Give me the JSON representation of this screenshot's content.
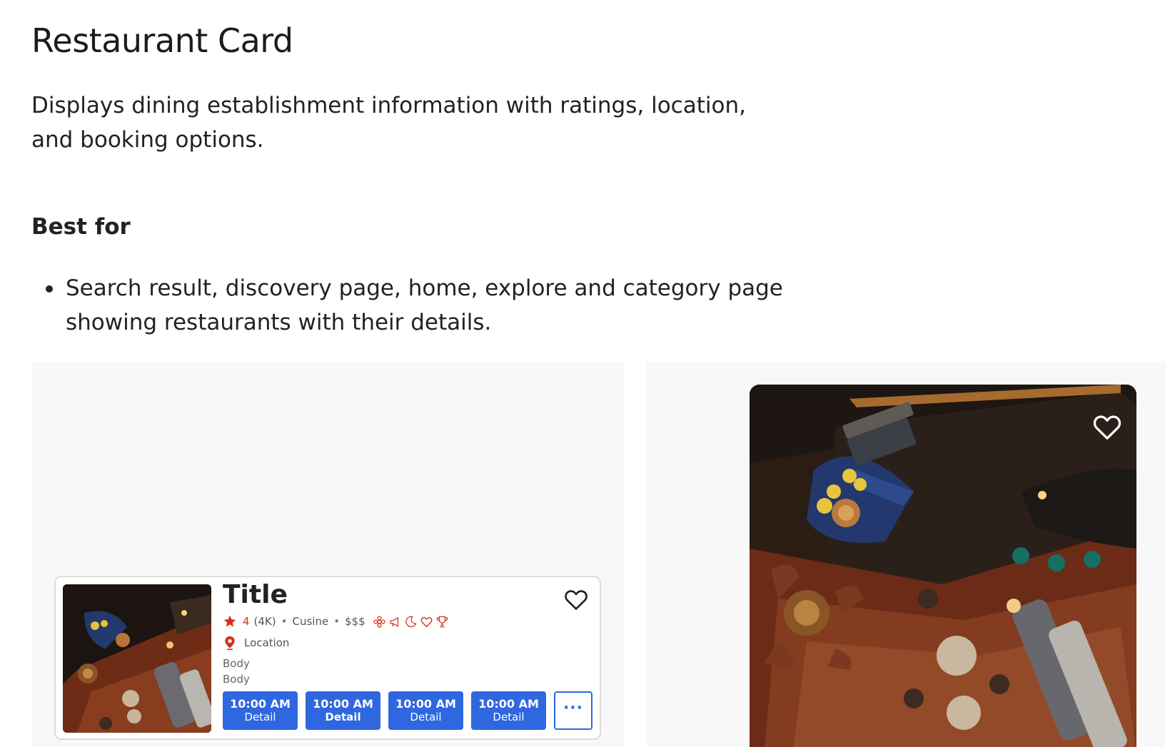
{
  "page": {
    "title": "Restaurant Card",
    "description": "Displays dining establishment information with ratings, location, and booking options.",
    "best_for_heading": "Best for",
    "best_for_items": [
      "Search result, discovery page, home, explore and category page showing restaurants with their details."
    ]
  },
  "card": {
    "title": "Title",
    "rating": "4",
    "review_count": "(4K)",
    "cuisine": "Cusine",
    "price": "$$$",
    "location": "Location",
    "body_lines": [
      "Body",
      "Body"
    ],
    "time_slots": [
      {
        "time": "10:00 AM",
        "label": "Detail"
      },
      {
        "time": "10:00 AM",
        "label": "Detail"
      },
      {
        "time": "10:00 AM",
        "label": "Detail"
      },
      {
        "time": "10:00 AM",
        "label": "Detail"
      }
    ],
    "more_label": "···",
    "feature_icons": [
      "flower-icon",
      "megaphone-icon",
      "moon-icon",
      "heart-outline-icon",
      "trophy-icon"
    ]
  },
  "colors": {
    "accent_blue": "#2f67e0",
    "rating_red": "#d0321b",
    "panel_bg": "#f8f8f8"
  }
}
